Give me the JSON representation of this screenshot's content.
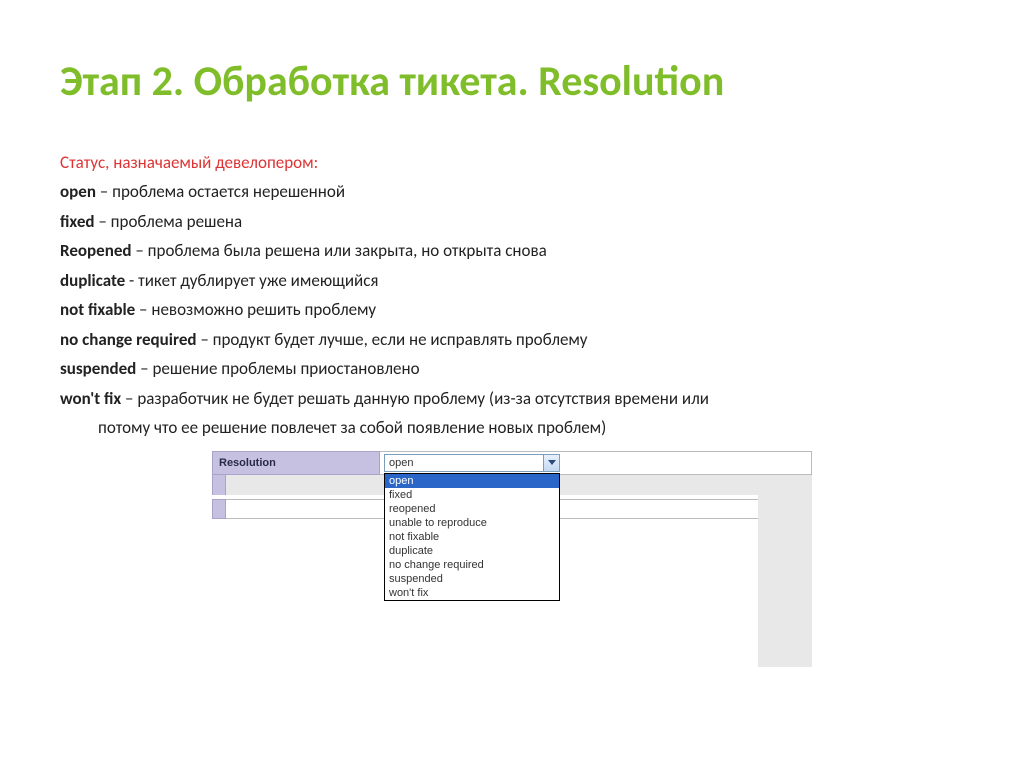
{
  "title": "Этап 2. Обработка тикета. Resolution",
  "subtitle": "Статус, назначаемый девелопером:",
  "defs": {
    "open_term": "open",
    "open_desc": " – проблема остается нерешенной",
    "fixed_term": "fixed",
    "fixed_desc": " – проблема решена",
    "reopened_term": "Reopened",
    "reopened_desc": " – проблема была решена или закрыта, но открыта снова",
    "duplicate_term": "duplicate",
    "duplicate_desc": "  - тикет дублирует уже имеющийся",
    "notfixable_term": "not fixable",
    "notfixable_desc": " – невозможно решить проблему",
    "nochange_term": "no change required",
    "nochange_desc": " – продукт будет лучше, если не исправлять проблему",
    "suspended_term": "suspended",
    "suspended_desc": " – решение проблемы приостановлено",
    "wontfix_term": "won't fix",
    "wontfix_desc": " – разработчик не будет решать данную проблему (из-за отсутствия времени или",
    "wontfix_desc2": "потому что ее решение повлечет за собой появление новых проблем)"
  },
  "ui": {
    "label": "Resolution",
    "selected": "open",
    "options": {
      "o0": "open",
      "o1": "fixed",
      "o2": "reopened",
      "o3": "unable to reproduce",
      "o4": "not fixable",
      "o5": "duplicate",
      "o6": "no change required",
      "o7": "suspended",
      "o8": "won't fix"
    }
  }
}
